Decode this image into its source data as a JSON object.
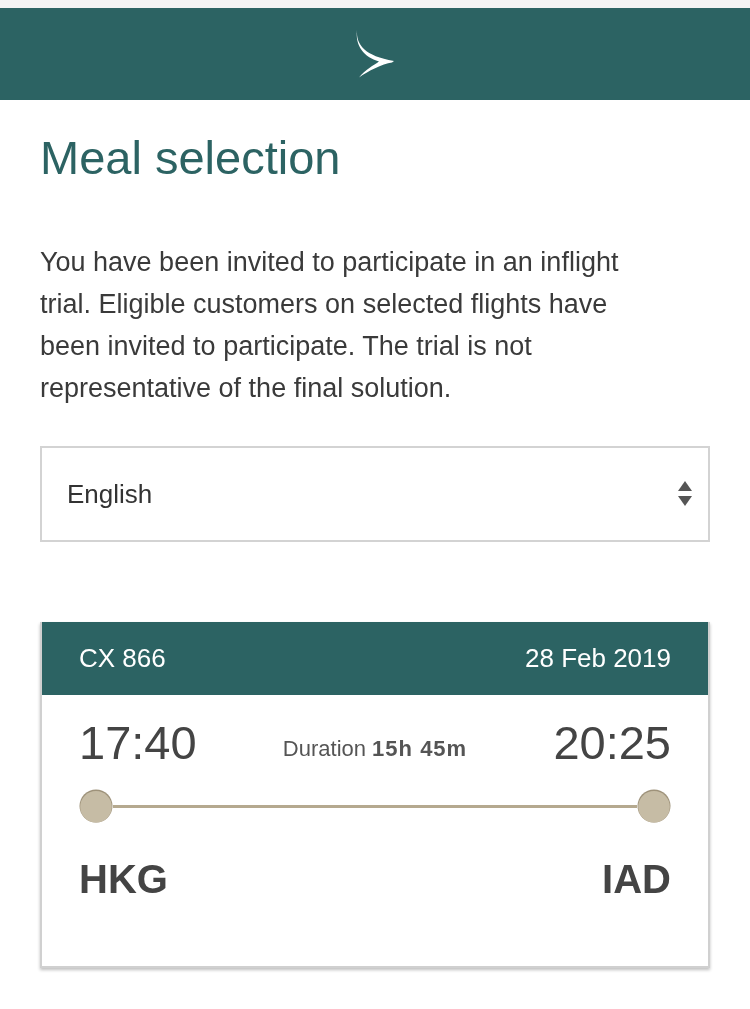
{
  "title": "Meal selection",
  "intro": "You have been invited to participate in an inflight trial. Eligible customers on selected flights have been invited to participate. The trial is not representative of the final solution.",
  "language_select": {
    "value": "English"
  },
  "flight": {
    "number": "CX 866",
    "date": "28 Feb 2019",
    "departure": {
      "time": "17:40",
      "airport": "HKG"
    },
    "duration": "Duration **15h 45m**",
    "arrival": {
      "time": "20:25",
      "airport": "IAD"
    }
  }
}
